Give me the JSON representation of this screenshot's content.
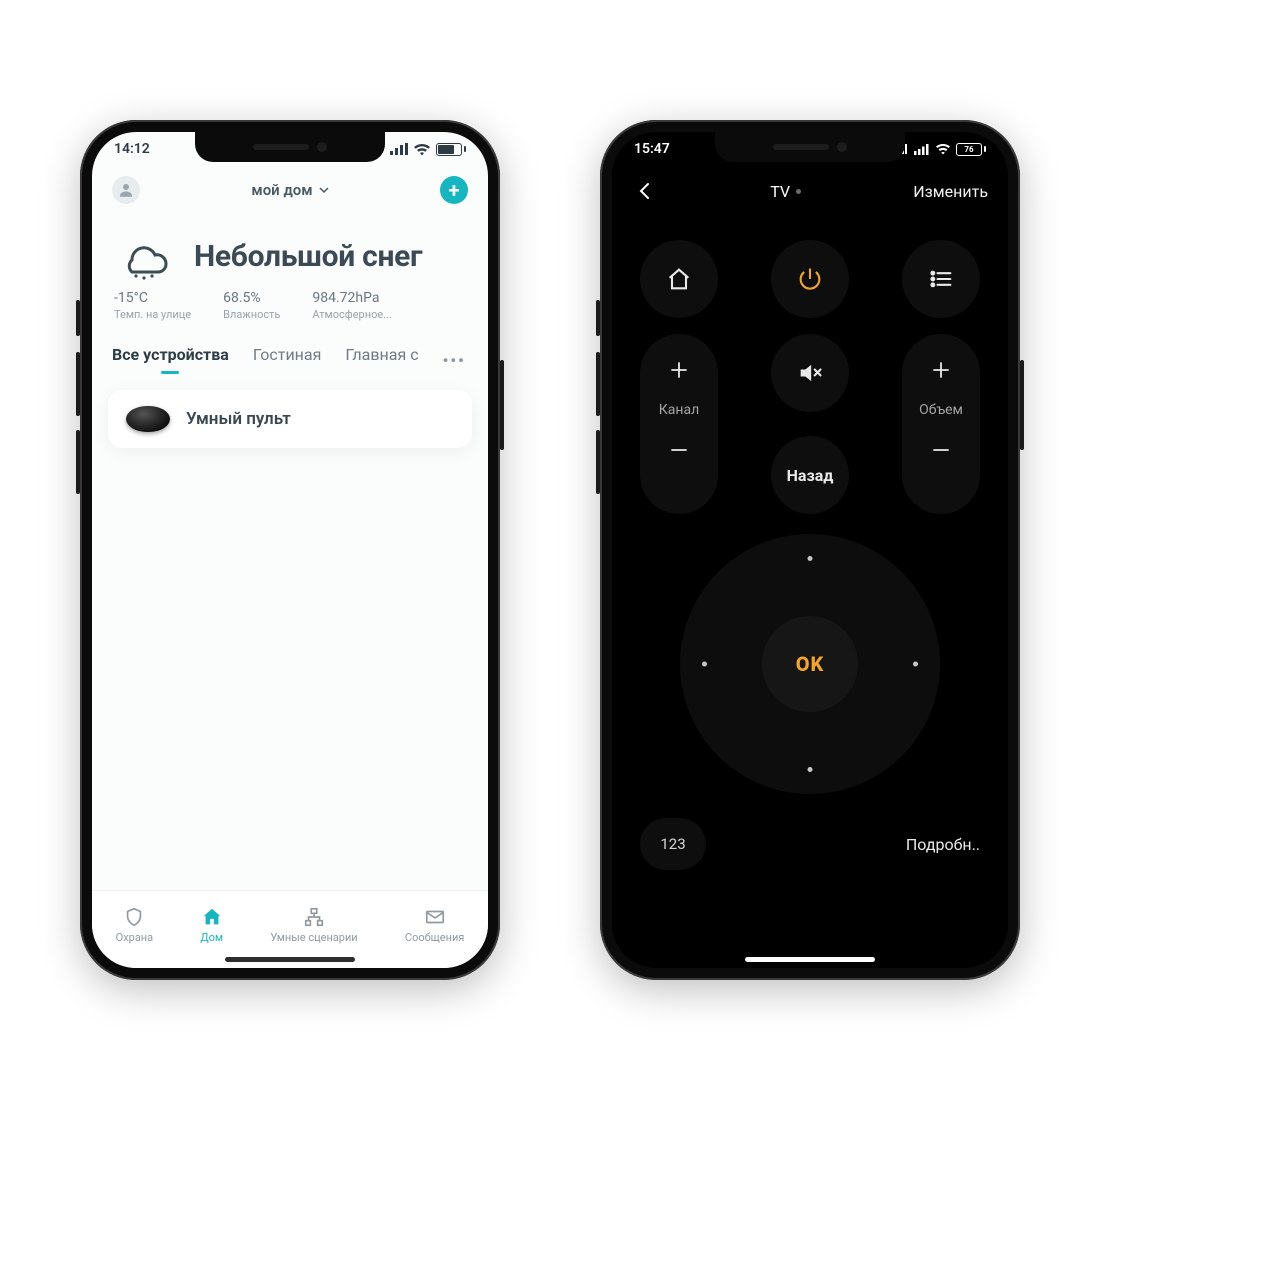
{
  "phone1": {
    "status": {
      "time": "14:12"
    },
    "header": {
      "home_selector": "мой дом"
    },
    "weather": {
      "title": "Небольшой снег",
      "metrics": [
        {
          "value": "-15°C",
          "label": "Темп. на улице"
        },
        {
          "value": "68.5%",
          "label": "Влажность"
        },
        {
          "value": "984.72hPa",
          "label": "Атмосферное..."
        }
      ]
    },
    "tabs": {
      "items": [
        "Все устройства",
        "Гостиная",
        "Главная с"
      ],
      "active_index": 0,
      "more": "•••"
    },
    "device": {
      "name": "Умный пульт"
    },
    "bottom_nav": {
      "items": [
        "Охрана",
        "Дом",
        "Умные сценарии",
        "Сообщения"
      ],
      "active_index": 1
    }
  },
  "phone2": {
    "status": {
      "time": "15:47",
      "battery": "76"
    },
    "header": {
      "title": "TV",
      "edit": "Изменить"
    },
    "remote": {
      "channel_label": "Канал",
      "volume_label": "Объем",
      "back_label": "Назад",
      "ok_label": "OK",
      "numpad": "123",
      "details": "Подробн.."
    }
  }
}
